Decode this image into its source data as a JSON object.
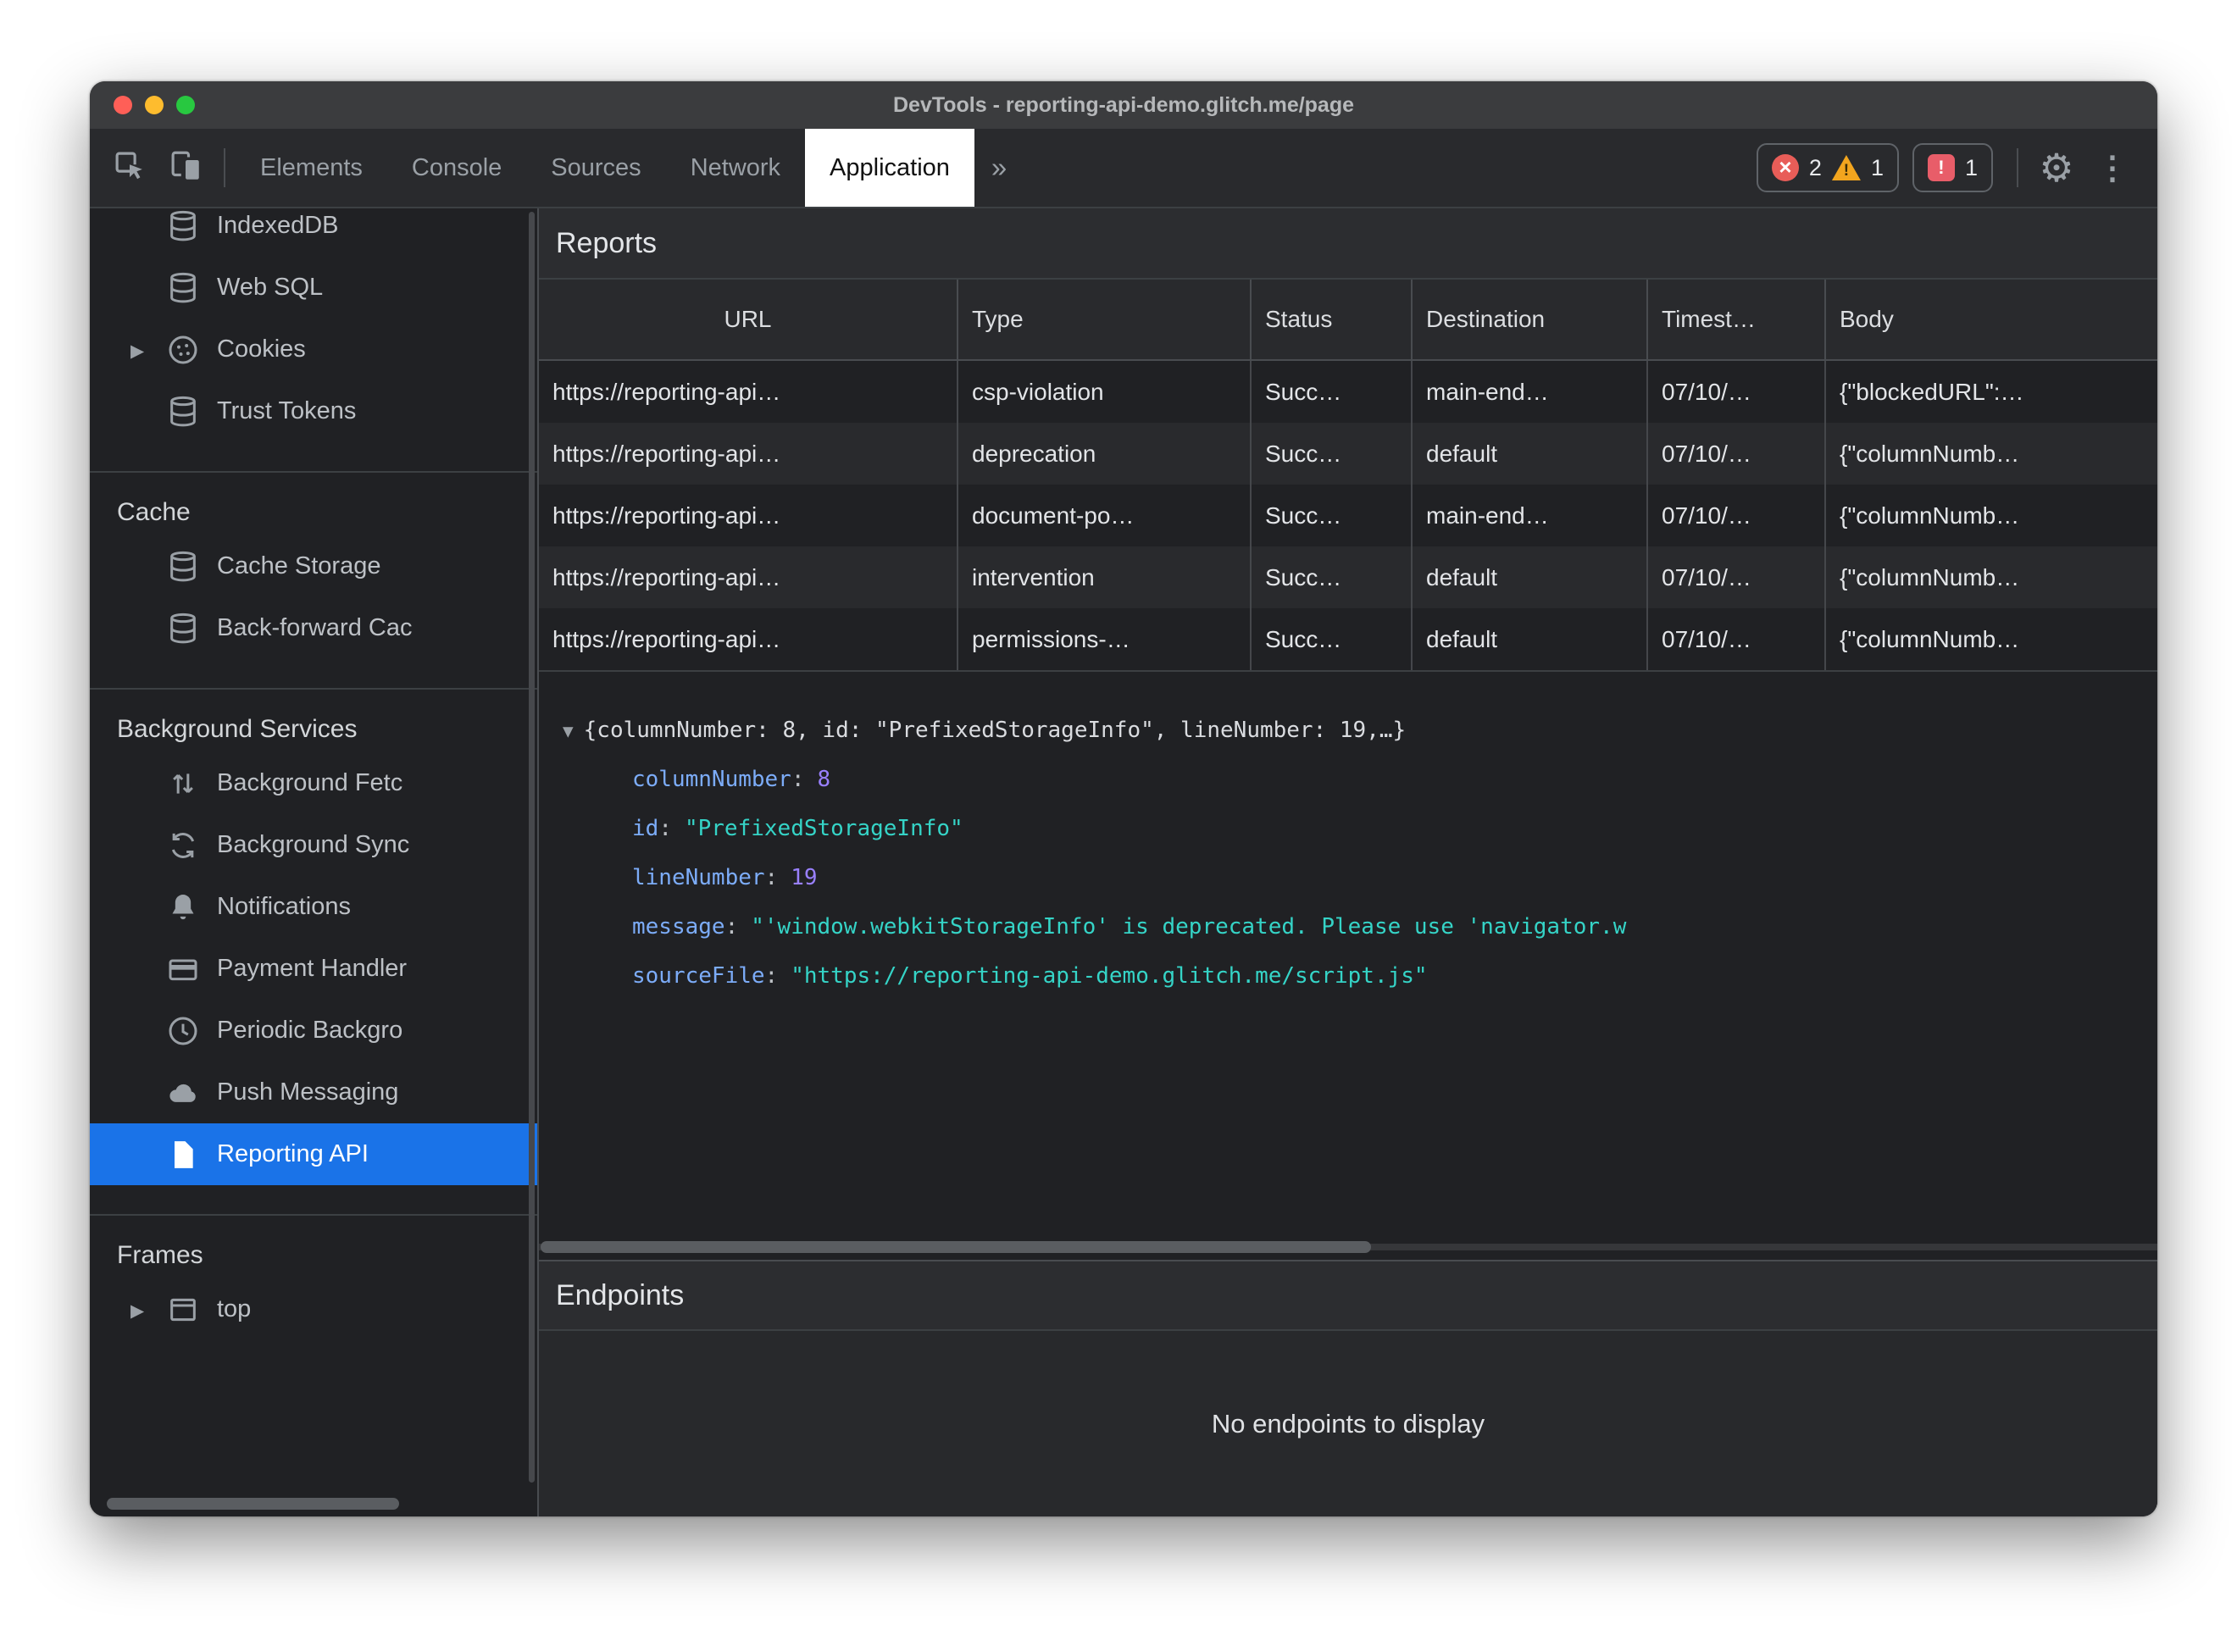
{
  "window": {
    "title": "DevTools - reporting-api-demo.glitch.me/page"
  },
  "toolbar": {
    "tabs": {
      "elements": "Elements",
      "console": "Console",
      "sources": "Sources",
      "network": "Network",
      "application": "Application"
    },
    "more_tabs": "»",
    "errors": {
      "count": "2"
    },
    "warnings": {
      "count": "1"
    },
    "issues": {
      "count": "1"
    }
  },
  "sidebar": {
    "storage_items": {
      "indexeddb": "IndexedDB",
      "websql": "Web SQL",
      "cookies": "Cookies",
      "trust_tokens": "Trust Tokens"
    },
    "cache": {
      "header": "Cache",
      "cache_storage": "Cache Storage",
      "back_forward": "Back-forward Cac"
    },
    "background_services": {
      "header": "Background Services",
      "background_fetch": "Background Fetc",
      "background_sync": "Background Sync",
      "notifications": "Notifications",
      "payment_handler": "Payment Handler",
      "periodic_background": "Periodic Backgro",
      "push_messaging": "Push Messaging",
      "reporting_api": "Reporting API"
    },
    "frames": {
      "header": "Frames",
      "top": "top"
    }
  },
  "reports": {
    "title": "Reports",
    "columns": {
      "url": "URL",
      "type": "Type",
      "status": "Status",
      "destination": "Destination",
      "timestamp": "Timest…",
      "body": "Body"
    },
    "rows": [
      {
        "url": "https://reporting-api…",
        "type": "csp-violation",
        "status": "Succ…",
        "destination": "main-end…",
        "timestamp": "07/10/…",
        "body": "{\"blockedURL\":…"
      },
      {
        "url": "https://reporting-api…",
        "type": "deprecation",
        "status": "Succ…",
        "destination": "default",
        "timestamp": "07/10/…",
        "body": "{\"columnNumb…"
      },
      {
        "url": "https://reporting-api…",
        "type": "document-po…",
        "status": "Succ…",
        "destination": "main-end…",
        "timestamp": "07/10/…",
        "body": "{\"columnNumb…"
      },
      {
        "url": "https://reporting-api…",
        "type": "intervention",
        "status": "Succ…",
        "destination": "default",
        "timestamp": "07/10/…",
        "body": "{\"columnNumb…"
      },
      {
        "url": "https://reporting-api…",
        "type": "permissions-…",
        "status": "Succ…",
        "destination": "default",
        "timestamp": "07/10/…",
        "body": "{\"columnNumb…"
      }
    ],
    "preview": {
      "summary": "{columnNumber: 8, id: \"PrefixedStorageInfo\", lineNumber: 19,…}",
      "properties": [
        {
          "name": "columnNumber",
          "value": "8",
          "type": "number"
        },
        {
          "name": "id",
          "value": "\"PrefixedStorageInfo\"",
          "type": "string"
        },
        {
          "name": "lineNumber",
          "value": "19",
          "type": "number"
        },
        {
          "name": "message",
          "value": "\"'window.webkitStorageInfo' is deprecated. Please use 'navigator.w",
          "type": "string"
        },
        {
          "name": "sourceFile",
          "value": "\"https://reporting-api-demo.glitch.me/script.js\"",
          "type": "string"
        }
      ]
    }
  },
  "endpoints": {
    "title": "Endpoints",
    "empty_message": "No endpoints to display"
  },
  "colors": {
    "selection_blue": "#1a73e8",
    "error_red": "#e85d58",
    "warning_yellow": "#f2a51e",
    "property_name_blue": "#7cacf8",
    "number_purple": "#9980ff",
    "string_teal": "#35d4c7"
  }
}
